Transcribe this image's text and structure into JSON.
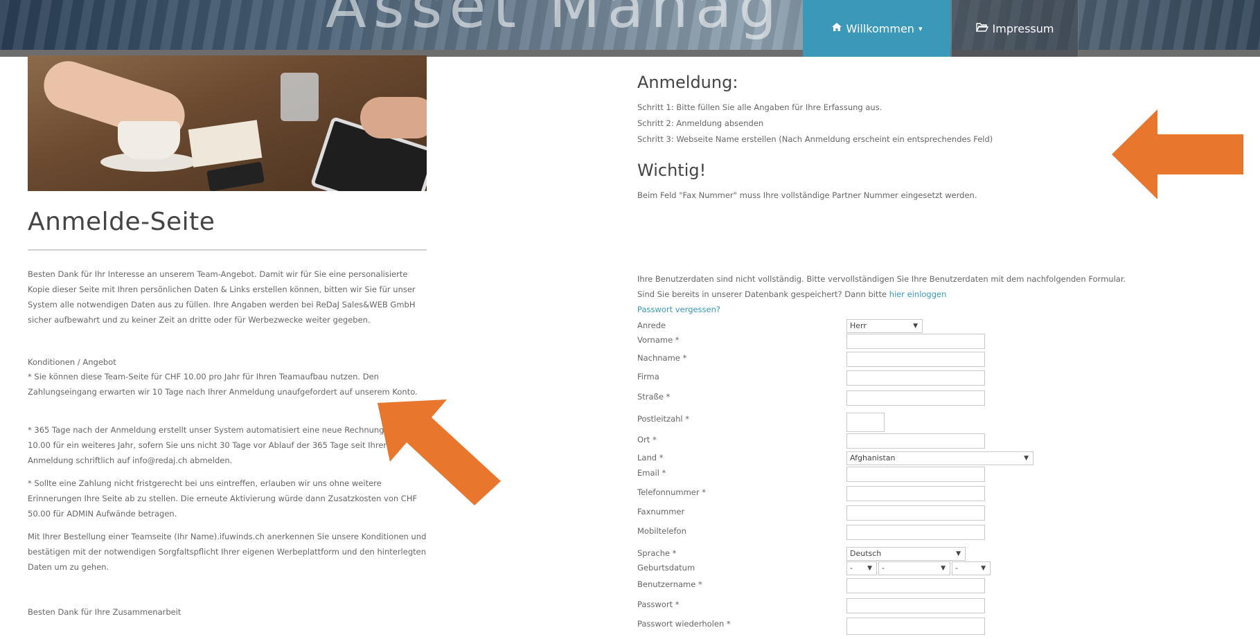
{
  "nav": {
    "welcome": "Willkommen",
    "welcome_caret": "▾",
    "impressum": "Impressum"
  },
  "left": {
    "page_title": "Anmelde-Seite",
    "intro_paragraph": "Besten Dank für Ihr Interesse an unserem Team-Angebot. Damit wir für Sie eine personalisierte Kopie dieser Seite mit Ihren persönlichen Daten & Links erstellen können, bitten wir Sie für unser System alle notwendigen Daten aus zu füllen. Ihre Angaben werden bei ReDaJ Sales&WEB GmbH sicher aufbewahrt und zu keiner Zeit an dritte oder für Werbezwecke weiter gegeben.",
    "conditions_title": "Konditionen / Angebot",
    "conditions_paragraph": "* Sie können diese Team-Seite für CHF 10.00 pro Jahr für Ihren Teamaufbau nutzen. Den Zahlungseingang erwarten wir 10 Tage nach Ihrer Anmeldung unaufgefordert auf unserem Konto.",
    "renewal_paragraph": "* 365 Tage nach der Anmeldung erstellt unser System automatisiert eine neue Rechnung von CHF 10.00 für ein weiteres Jahr, sofern Sie uns nicht 30 Tage vor Ablauf der 365 Tage seit Ihrer Anmeldung schriftlich auf info@redaj.ch abmelden.",
    "payment_paragraph": "* Sollte eine Zahlung nicht fristgerecht bei uns eintreffen, erlauben wir uns ohne weitere Erinnerungen Ihre Seite ab zu stellen. Die erneute Aktivierung würde dann Zusatzkosten von CHF 50.00 für ADMIN Aufwände betragen.",
    "order_paragraph": "Mit Ihrer Bestellung einer Teamseite (Ihr Name).ifuwinds.ch anerkennen Sie unsere Konditionen und bestätigen mit der notwendigen Sorgfaltspflicht Ihrer eigenen Werbeplattform und den hinterlegten Daten um zu gehen.",
    "thanks": "Besten Dank für Ihre Zusammenarbeit"
  },
  "right": {
    "registration_title": "Anmeldung:",
    "step1": "Schritt 1: Bitte füllen Sie alle Angaben für Ihre Erfassung aus.",
    "step2": "Schritt 2: Anmeldung absenden",
    "step3": "Schritt 3: Webseite Name erstellen (Nach Anmeldung erscheint ein entsprechendes Feld)",
    "important_title": "Wichtig!",
    "important_text": "Beim Feld \"Fax Nummer\" muss Ihre vollständige Partner Nummer eingesetzt werden.",
    "incomplete_text": "Ihre Benutzerdaten sind nicht vollständig. Bitte vervollständigen Sie Ihre Benutzerdaten mit dem nachfolgenden Formular.",
    "registered_text": "Sind Sie bereits in unserer Datenbank gespeichert? Dann bitte",
    "login_link": "hier einloggen",
    "forgot_link": "Passwort vergessen?"
  },
  "form": {
    "salutation_label": "Anrede",
    "salutation_value": "Herr",
    "firstname_label": "Vorname *",
    "lastname_label": "Nachname *",
    "company_label": "Firma",
    "street_label": "Straße *",
    "zip_label": "Postleitzahl *",
    "city_label": "Ort *",
    "country_label": "Land *",
    "country_value": "Afghanistan",
    "email_label": "Email *",
    "phone_label": "Telefonnummer *",
    "fax_label": "Faxnummer",
    "mobile_label": "Mobiltelefon",
    "language_label": "Sprache *",
    "language_value": "Deutsch",
    "birthdate_label": "Geburtsdatum",
    "birthdate_day": "-",
    "birthdate_month": "-",
    "birthdate_year": "-",
    "username_label": "Benutzername *",
    "password_label": "Passwort *",
    "password_repeat_label": "Passwort wiederholen *"
  },
  "colors": {
    "accent": "#3a99b8",
    "arrow": "#e8762d"
  },
  "icons": {
    "home": "home-icon",
    "folder": "folder-open-icon"
  }
}
